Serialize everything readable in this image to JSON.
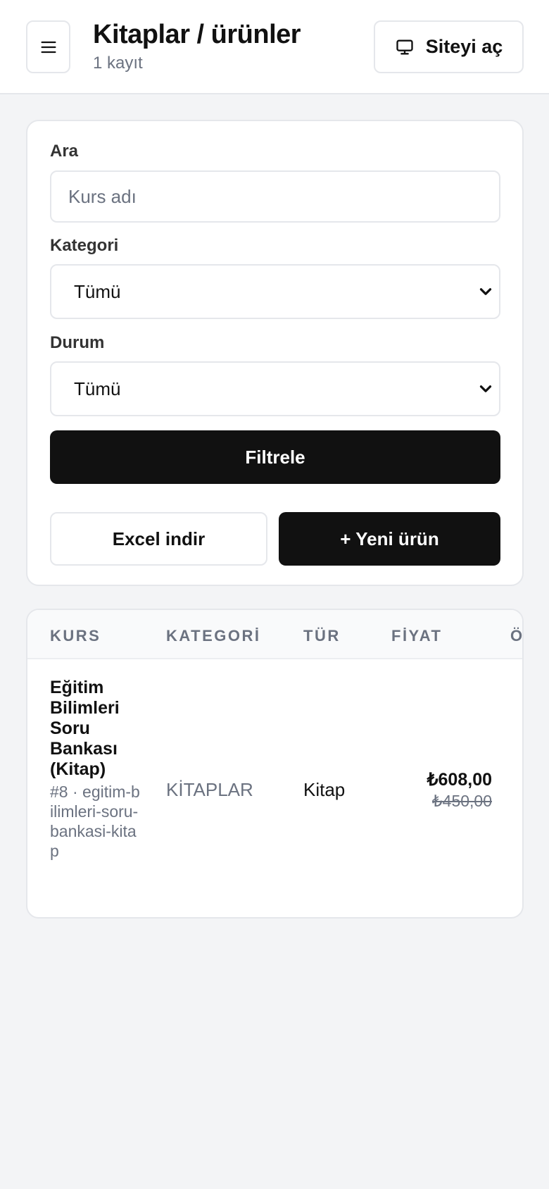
{
  "header": {
    "title": "Kitaplar / ürünler",
    "subtitle": "1 kayıt",
    "menu_icon": "hamburger-menu-icon",
    "site_button": {
      "icon": "monitor-icon",
      "label": "Siteyi aç"
    }
  },
  "filters": {
    "search": {
      "label": "Ara",
      "placeholder": "Kurs adı",
      "value": ""
    },
    "category": {
      "label": "Kategori",
      "value": "Tümü"
    },
    "status": {
      "label": "Durum",
      "value": "Tümü"
    },
    "filter_button": "Filtrele",
    "excel_button": "Excel indir",
    "new_button": "+ Yeni ürün"
  },
  "table": {
    "headers": [
      "KURS",
      "KATEGORİ",
      "TÜR",
      "FİYAT",
      "Ö"
    ],
    "rows": [
      {
        "name": "Eğitim Bilimleri Soru Bankası (Kitap)",
        "meta": "#8 · egitim-bilimleri-soru-bankasi-kitap",
        "category": "KİTAPLAR",
        "type": "Kitap",
        "price": "₺608,00",
        "old_price": "₺450,00"
      }
    ]
  },
  "colors": {
    "background": "#f3f4f6",
    "primary_dark": "#111111",
    "muted_text": "#6b7280",
    "border": "#e5e7eb"
  }
}
